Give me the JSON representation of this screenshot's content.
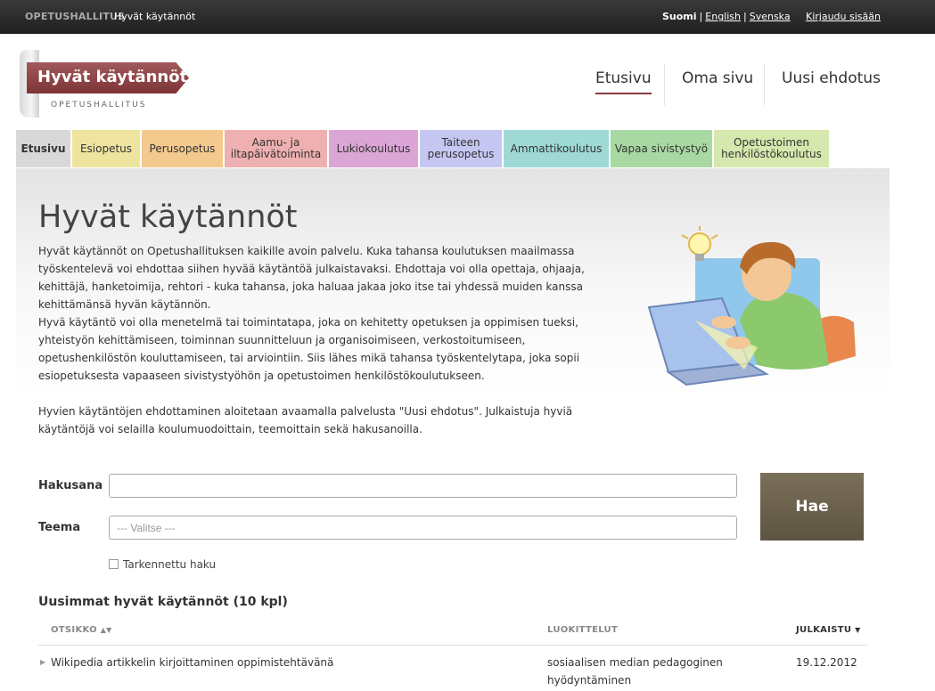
{
  "topbar": {
    "org": "OPETUSHALLITUS",
    "site": "Hyvät käytännöt",
    "lang_current": "Suomi",
    "lang_en": "English",
    "lang_sv": "Svenska",
    "separator": "|",
    "login": "Kirjaudu sisään"
  },
  "logo": {
    "title": "Hyvät käytännöt",
    "subtitle": "OPETUSHALLITUS"
  },
  "mainnav": {
    "home": "Etusivu",
    "own": "Oma sivu",
    "new": "Uusi ehdotus"
  },
  "tabs": [
    {
      "label": "Etusivu",
      "color": "#d8d8d8"
    },
    {
      "label": "Esiopetus",
      "color": "#efe3a0"
    },
    {
      "label": "Perusopetus",
      "color": "#f3c98e"
    },
    {
      "label": "Aamu- ja iltapäivätoiminta",
      "color": "#eeb0b0"
    },
    {
      "label": "Lukiokoulutus",
      "color": "#dba6d6"
    },
    {
      "label": "Taiteen perusopetus",
      "color": "#c6c6f2"
    },
    {
      "label": "Ammattikoulutus",
      "color": "#9ed9d5"
    },
    {
      "label": "Vapaa sivistystyö",
      "color": "#a9d9a2"
    },
    {
      "label": "Opetustoimen henkilöstökoulutus",
      "color": "#d7e8ae"
    }
  ],
  "page": {
    "title": "Hyvät käytännöt",
    "p1": "Hyvät käytännöt on Opetushallituksen kaikille avoin palvelu. Kuka tahansa koulutuksen maailmassa työskentelevä voi ehdottaa siihen hyvää käytäntöä julkaistavaksi. Ehdottaja voi olla opettaja, ohjaaja, kehittäjä, hanketoimija, rehtori - kuka tahansa, joka haluaa jakaa joko itse tai yhdessä muiden kanssa kehittämänsä hyvän käytännön.",
    "p2": "Hyvä käytäntö voi olla menetelmä tai toimintatapa, joka on kehitetty opetuksen ja oppimisen tueksi, yhteistyön kehittämiseen, toiminnan suunnitteluun ja organisoimiseen, verkostoitumiseen, opetushenkilöstön kouluttamiseen, tai arviointiin. Siis lähes mikä tahansa työskentelytapa, joka sopii esiopetuksesta vapaaseen sivistystyöhön ja opetustoimen henkilöstökoulutukseen.",
    "p3": "Hyvien käytäntöjen ehdottaminen aloitetaan avaamalla palvelusta \"Uusi ehdotus\". Julkaistuja hyviä käytäntöjä voi selailla koulumuodoittain, teemoittain sekä hakusanoilla."
  },
  "search": {
    "keyword_label": "Hakusana",
    "keyword_value": "",
    "theme_label": "Teema",
    "theme_value": "--- Valitse ---",
    "submit": "Hae",
    "advanced": "Tarkennettu haku"
  },
  "list": {
    "title": "Uusimmat hyvät käytännöt (10 kpl)",
    "col_title": "OTSIKKO",
    "col_tags": "LUOKITTELUT",
    "col_published": "JULKAISTU",
    "rows": [
      {
        "title": "Wikipedia artikkelin kirjoittaminen oppimistehtävänä",
        "tags_line1": "sosiaalisen median pedagoginen",
        "tags_line2": "hyödyntäminen",
        "date": "19.12.2012"
      }
    ]
  },
  "icons": {
    "sort": "sort-arrows-icon",
    "sort_desc": "caret-down-icon",
    "row_expand": "caret-right-icon",
    "checkbox": "checkbox-icon"
  },
  "colors": {
    "accent": "#8b3a3d",
    "button": "#6b6250"
  }
}
